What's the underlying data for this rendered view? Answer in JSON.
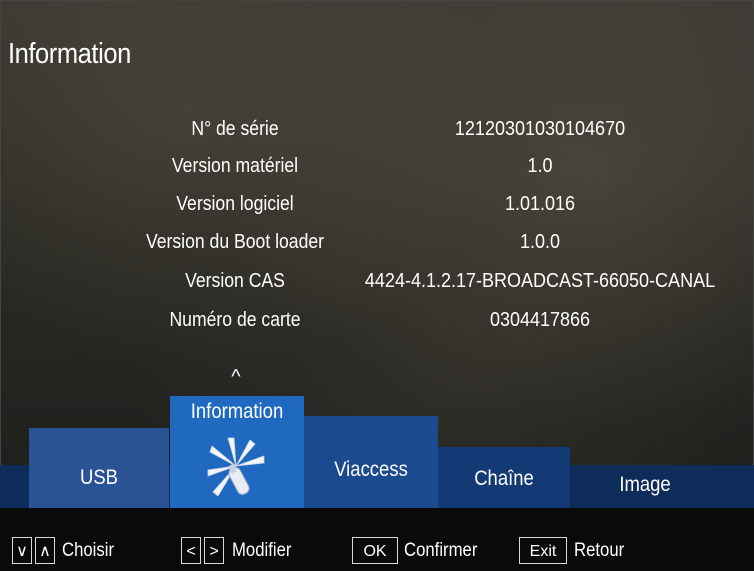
{
  "header": {
    "title": "Information"
  },
  "info": [
    {
      "label": "N° de série",
      "value": "12120301030104670"
    },
    {
      "label": "Version matériel",
      "value": "1.0"
    },
    {
      "label": "Version logiciel",
      "value": "1.01.016"
    },
    {
      "label": "Version du Boot loader",
      "value": "1.0.0"
    },
    {
      "label": "Version CAS",
      "value": "4424-4.1.2.17-BROADCAST-66050-CANAL"
    },
    {
      "label": "Numéro de carte",
      "value": "0304417866"
    }
  ],
  "menu": {
    "up_glyph": "^",
    "tabs": [
      {
        "label": "USB"
      },
      {
        "label": "Information",
        "selected": true,
        "icon": "tools-icon"
      },
      {
        "label": "Viaccess"
      },
      {
        "label": "Chaîne"
      },
      {
        "label": "Image"
      }
    ]
  },
  "footer": {
    "down_key": "∨",
    "up_key": "∧",
    "choose_label": "Choisir",
    "left_key": "<",
    "right_key": ">",
    "modify_label": "Modifier",
    "ok_key": "OK",
    "confirm_label": "Confirmer",
    "exit_key": "Exit",
    "back_label": "Retour"
  },
  "colors": {
    "menu_bar": "#0e2c5a",
    "selected_tab": "#1f69c1",
    "tab": "#1f4a8c"
  }
}
